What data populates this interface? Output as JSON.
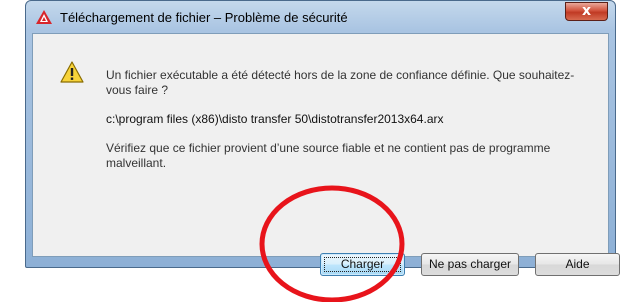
{
  "window": {
    "title": "Téléchargement de fichier – Problème de sécurité",
    "close_glyph": "x"
  },
  "icons": {
    "app": "autocad-app-icon",
    "warning": "warning-icon",
    "close": "close-icon"
  },
  "message": {
    "line1": "Un fichier exécutable a été détecté hors de la zone de confiance définie. Que souhaitez-vous faire ?",
    "path": "c:\\program files (x86)\\disto transfer 50\\distotransfer2013x64.arx",
    "line2": "Vérifiez que ce fichier provient d’une source fiable et ne contient pas de programme malveillant."
  },
  "buttons": {
    "load": "Charger",
    "dont_load": "Ne pas charger",
    "help": "Aide"
  },
  "colors": {
    "annotation": "#e8141b",
    "app_icon": "#d8262b",
    "warning_fill": "#f7d33a"
  }
}
